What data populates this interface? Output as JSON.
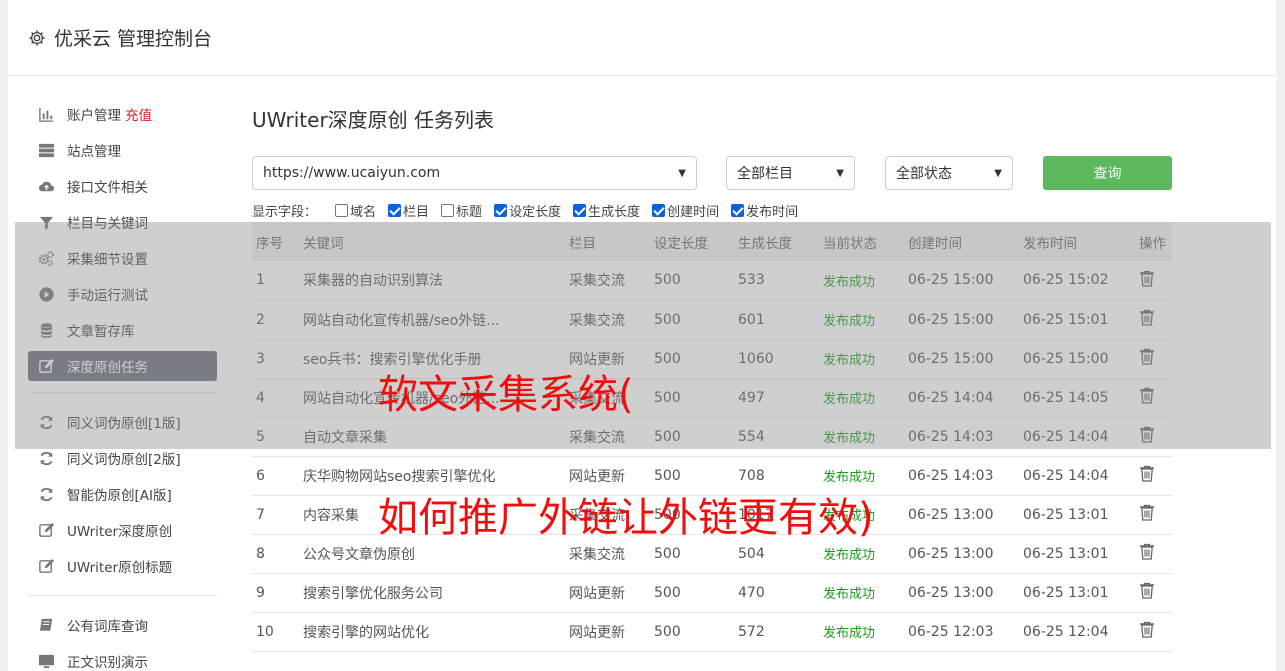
{
  "header": {
    "title": "优采云 管理控制台",
    "icon": "gear-icon"
  },
  "sidebar": {
    "items": [
      {
        "label": "账户管理",
        "extra": "充值",
        "icon": "bar-chart-icon"
      },
      {
        "label": "站点管理",
        "icon": "server-icon"
      },
      {
        "label": "接口文件相关",
        "icon": "cloud-upload-icon"
      },
      {
        "label": "栏目与关键词",
        "icon": "filter-icon"
      },
      {
        "label": "采集细节设置",
        "icon": "gears-icon"
      },
      {
        "label": "手动运行测试",
        "icon": "play-circle-icon"
      },
      {
        "label": "文章暂存库",
        "icon": "database-icon"
      },
      {
        "label": "深度原创任务",
        "icon": "edit-icon"
      }
    ],
    "items2": [
      {
        "label": "同义词伪原创[1版]",
        "icon": "refresh-icon"
      },
      {
        "label": "同义词伪原创[2版]",
        "icon": "refresh-icon"
      },
      {
        "label": "智能伪原创[AI版]",
        "icon": "refresh-icon"
      },
      {
        "label": "UWriter深度原创",
        "icon": "edit-icon"
      },
      {
        "label": "UWriter原创标题",
        "icon": "edit-icon"
      }
    ],
    "items3": [
      {
        "label": "公有词库查询",
        "icon": "book-icon"
      },
      {
        "label": "正文识别演示",
        "icon": "monitor-icon"
      }
    ]
  },
  "main": {
    "title": "UWriter深度原创 任务列表",
    "site_select": "https://www.ucaiyun.com",
    "column_select": "全部栏目",
    "status_select": "全部状态",
    "query_button": "查询",
    "fields_label": "显示字段：",
    "fields": [
      {
        "label": "域名",
        "checked": false
      },
      {
        "label": "栏目",
        "checked": true
      },
      {
        "label": "标题",
        "checked": false
      },
      {
        "label": "设定长度",
        "checked": true
      },
      {
        "label": "生成长度",
        "checked": true
      },
      {
        "label": "创建时间",
        "checked": true
      },
      {
        "label": "发布时间",
        "checked": true
      }
    ],
    "columns": [
      "序号",
      "关键词",
      "栏目",
      "设定长度",
      "生成长度",
      "当前状态",
      "创建时间",
      "发布时间",
      "操作"
    ],
    "rows": [
      [
        "1",
        "采集器的自动识别算法",
        "采集交流",
        "500",
        "533",
        "发布成功",
        "06-25 15:00",
        "06-25 15:02"
      ],
      [
        "2",
        "网站自动化宣传机器/seo外链...",
        "采集交流",
        "500",
        "601",
        "发布成功",
        "06-25 15:00",
        "06-25 15:01"
      ],
      [
        "3",
        "seo兵书：搜索引擎优化手册",
        "网站更新",
        "500",
        "1060",
        "发布成功",
        "06-25 15:00",
        "06-25 15:00"
      ],
      [
        "4",
        "网站自动化宣传机器/seo外链...",
        "采集交流",
        "500",
        "497",
        "发布成功",
        "06-25 14:04",
        "06-25 14:05"
      ],
      [
        "5",
        "自动文章采集",
        "采集交流",
        "500",
        "554",
        "发布成功",
        "06-25 14:03",
        "06-25 14:04"
      ],
      [
        "6",
        "庆华购物网站seo搜索引擎优化",
        "网站更新",
        "500",
        "708",
        "发布成功",
        "06-25 14:03",
        "06-25 14:04"
      ],
      [
        "7",
        "内容采集",
        "采集交流",
        "500",
        "1017",
        "发布成功",
        "06-25 13:00",
        "06-25 13:01"
      ],
      [
        "8",
        "公众号文章伪原创",
        "采集交流",
        "500",
        "504",
        "发布成功",
        "06-25 13:00",
        "06-25 13:01"
      ],
      [
        "9",
        "搜索引擎优化服务公司",
        "网站更新",
        "500",
        "470",
        "发布成功",
        "06-25 13:00",
        "06-25 13:01"
      ],
      [
        "10",
        "搜索引擎的网站优化",
        "网站更新",
        "500",
        "572",
        "发布成功",
        "06-25 12:03",
        "06-25 12:04"
      ]
    ],
    "delete_icon": "trash-icon"
  },
  "watermark": {
    "line1": "软文采集系统(",
    "line2": "如何推广外链让外链更有效)"
  },
  "colors": {
    "accent_green": "#5cb85c",
    "success_text": "#1c9b1c",
    "active_nav": "#6b717d",
    "watermark_red": "#f20d0d"
  }
}
